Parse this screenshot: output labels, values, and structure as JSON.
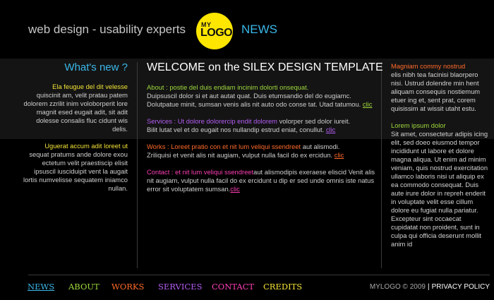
{
  "header": {
    "tagline": "web design - usability experts",
    "logo_my": "MY",
    "logo_word": "LOGO",
    "news": "NEWS"
  },
  "left": {
    "title": "What's new ?",
    "item1_title": "Ela feugue del dit velesse",
    "item1_body": "quiscinit am, velit pratau patem dolorem zzrilit inim voloborperit lore magnit esed eugait adit, sit adit dolesse consalis fluc cidunt wis delis.",
    "item2_title": "Uguerat accum adit loreet ut",
    "item2_body": "sequat pratums ande dolore exou ectetum velit praestiscip elisit ipsuscil iusciduipit vent la augait lortis numvelisse sequatem iniamco nullan."
  },
  "main": {
    "welcome": "WELCOME on the SILEX DESIGN TEMPLATE",
    "about_title": "About : postie del duis endiam incinim dolorti onsequat.",
    "about_body": "Duipsuscil dolor si et aut autat quat. Duis etumsandio del do eugiamc. Dolutpatue minit, sumsan venis alis nit auto odo conse tat. Utad tatumou.",
    "services_title": "Services : Ut dolore dolorercip endit dolorem",
    "services_body_a": " volorper sed dolor iureit.",
    "services_body_b": "Bilit lutat vel et do eugait nos nullandip estrud eniat, conullut.",
    "works_title": "Works : Loreet pratio con et nit lum veliqui ssendreet",
    "works_body_a": " aut alismodi.",
    "works_body_b": "Zriliquisi et venit alis nit augiam, vulput nulla facil do ex ercidun.",
    "contact_title": "Contact : et nit lum veliqui ssendreet",
    "contact_body": "aut alismodipis exeraese eliscid Venit alis nit augiam, vulput nulla facil do ex ercidunt u dip er sed  unde omnis iste natus error sit voluptatem sumsan.",
    "clic": "clic"
  },
  "right": {
    "title1": "Magniam commy nostrud",
    "body1": "elis nibh tea facinisi blaorpero nisi. Ustrud dolendre min hent aliquam consequis nostiemum etuer ing et, sent prat, corem quisissim at wissit utaht estu.",
    "title2": "Lorem ipsum dolor",
    "body2": "Sit amet, consectetur adipis icing elit, sed doeo eiusmod tempor incididunt ut labore et dolore magna aliqua. Ut enim ad minim veniam, quis nostrud exercitation ullamco laboris nisi ut aliquip ex ea commodo consequat. Duis aute irure dolor in repreh enderit in voluptate velit esse cillum dolore eu fugiat nulla pariatur. Excepteur sint occaecat cupidatat non proident, sunt in culpa qui officia deserunt mollit anim id"
  },
  "footer": {
    "nav": [
      {
        "label": "NEWS",
        "color": "#3ab7e8"
      },
      {
        "label": "ABOUT",
        "color": "#9fd93d"
      },
      {
        "label": "WORKS",
        "color": "#ff6a2a"
      },
      {
        "label": "SERVICES",
        "color": "#b45df5"
      },
      {
        "label": "CONTACT",
        "color": "#ff3fb6"
      },
      {
        "label": "CREDITS",
        "color": "#f2e236"
      }
    ],
    "copyright": "MYLOGO © 2009",
    "separator": "|",
    "privacy": "PRIVACY POLICY"
  },
  "colors": {
    "accent_blue": "#3ab7e8",
    "accent_green": "#9fd93d",
    "accent_orange": "#ff6a2a",
    "accent_purple": "#b45df5",
    "accent_pink": "#ff3fb6",
    "accent_yellow": "#f2e236",
    "logo_yellow": "#ffe600"
  }
}
